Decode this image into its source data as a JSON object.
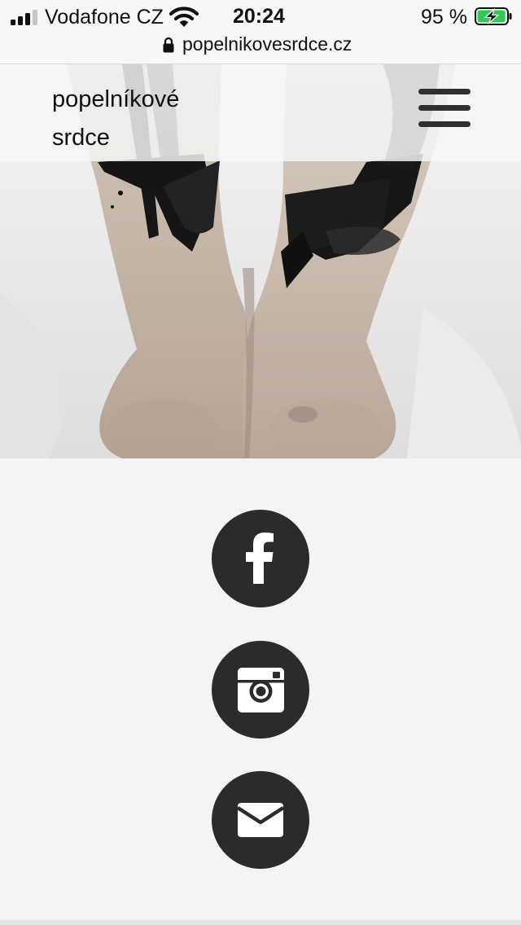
{
  "status_bar": {
    "carrier": "Vodafone CZ",
    "time": "20:24",
    "battery_percent": "95 %",
    "battery_level": 0.95,
    "signal_bars": 3,
    "signal_bars_total": 4,
    "battery_color": "#34c759"
  },
  "browser": {
    "url": "popelnikovesrdce.cz"
  },
  "site": {
    "logo": "popelníkové srdce"
  },
  "social": {
    "links": [
      {
        "icon": "facebook-icon"
      },
      {
        "icon": "instagram-icon"
      },
      {
        "icon": "mail-icon"
      }
    ],
    "button_color": "#2b2b2b"
  },
  "colors": {
    "page_background": "#f4f4f4"
  }
}
